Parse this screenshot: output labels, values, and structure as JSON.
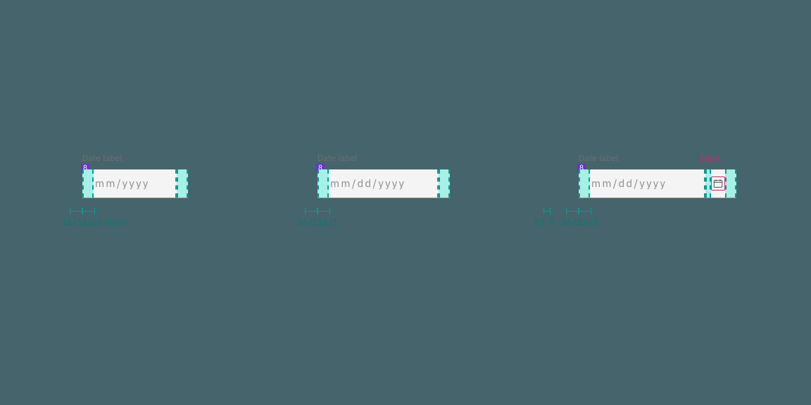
{
  "labels": {
    "date_label": "Date label",
    "gap_badge": "8"
  },
  "placeholders": {
    "simple": "mm/yyyy",
    "single": "mm/dd/yyyy",
    "icon": "mm/dd/yyyy"
  },
  "measurements": {
    "sixteen_full": "16px/1rem",
    "sixteen_short": "16/1",
    "eight_half": "8/.5",
    "icon_size": "16px"
  },
  "colors": {
    "highlight": "#a7f0e5",
    "dash": "#009d9a",
    "magenta": "#d12771",
    "purple": "#6a32c9"
  }
}
